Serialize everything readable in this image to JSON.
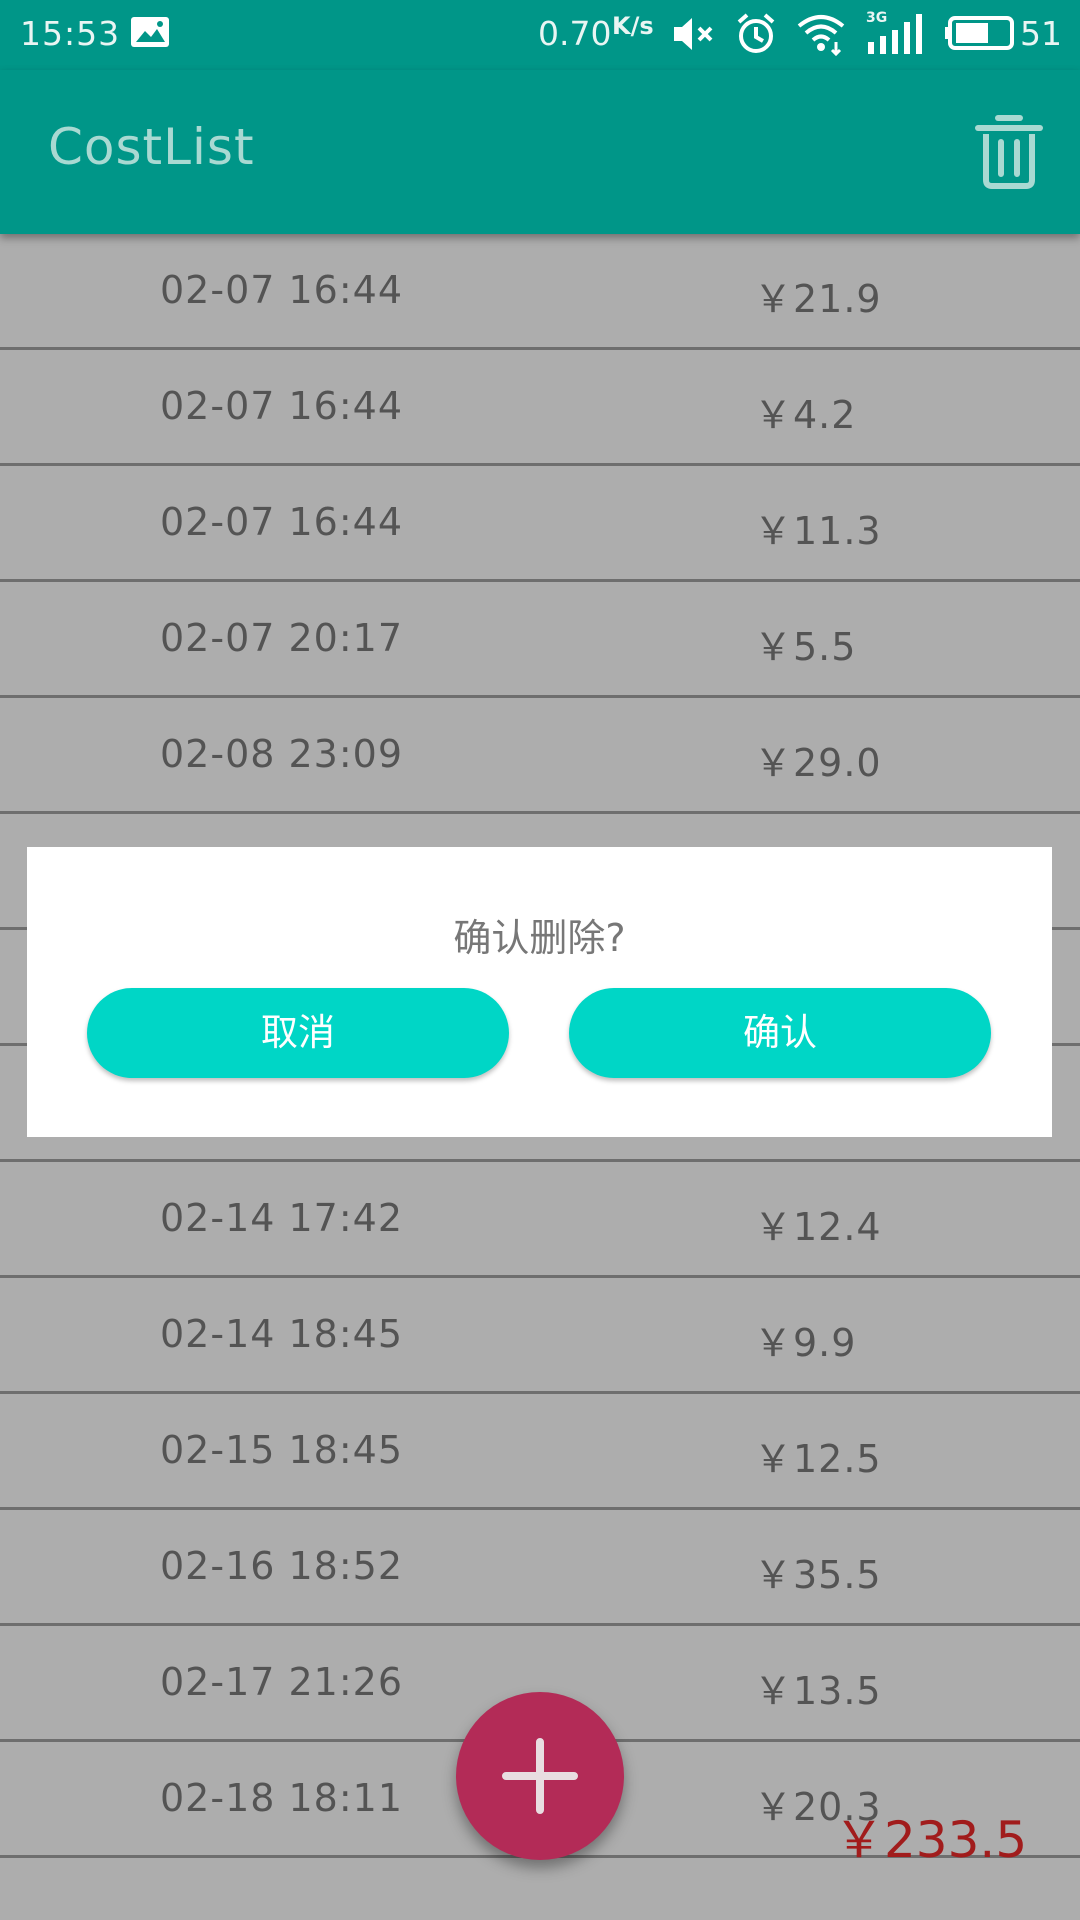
{
  "status_bar": {
    "time": "15:53",
    "net_speed": "0.70",
    "net_speed_unit": "K/s",
    "signal_label": "3G",
    "battery": "51"
  },
  "app_bar": {
    "title": "CostList",
    "delete_icon": "trash-icon"
  },
  "costs": [
    {
      "date": "02-07 16:44",
      "amount": "￥21.9"
    },
    {
      "date": "02-07 16:44",
      "amount": "￥4.2"
    },
    {
      "date": "02-07 16:44",
      "amount": "￥11.3"
    },
    {
      "date": "02-07 20:17",
      "amount": "￥5.5"
    },
    {
      "date": "02-08 23:09",
      "amount": "￥29.0"
    },
    {
      "date": "",
      "amount": ""
    },
    {
      "date": "",
      "amount": ""
    },
    {
      "date": "",
      "amount": ""
    },
    {
      "date": "02-14 17:42",
      "amount": "￥12.4"
    },
    {
      "date": "02-14 18:45",
      "amount": "￥9.9"
    },
    {
      "date": "02-15 18:45",
      "amount": "￥12.5"
    },
    {
      "date": "02-16 18:52",
      "amount": "￥35.5"
    },
    {
      "date": "02-17 21:26",
      "amount": "￥13.5"
    },
    {
      "date": "02-18 18:11",
      "amount": "￥20.3"
    }
  ],
  "dialog": {
    "message": "确认删除?",
    "cancel_label": "取消",
    "confirm_label": "确认"
  },
  "fab": {
    "icon": "plus-icon"
  },
  "total": "￥233.5",
  "colors": {
    "primary": "#009688",
    "accent_button": "#00d6c6",
    "fab": "#b32b57",
    "total_text": "#a11c1c"
  }
}
